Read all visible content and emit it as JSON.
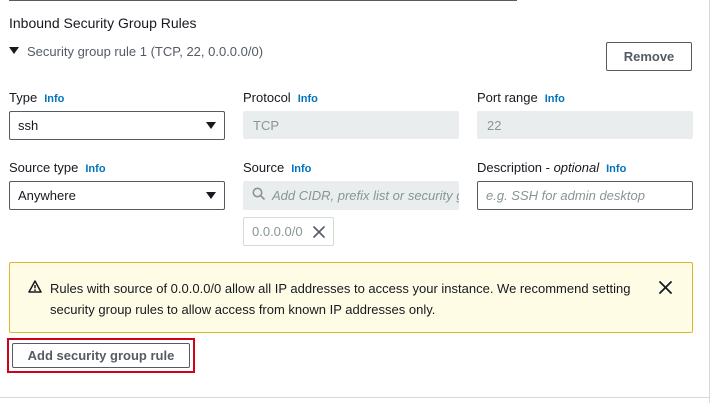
{
  "section": {
    "title": "Inbound Security Group Rules"
  },
  "rule": {
    "header": "Security group rule 1 (TCP, 22, 0.0.0.0/0)",
    "remove_label": "Remove"
  },
  "fields": {
    "info_label": "Info",
    "type": {
      "label": "Type",
      "value": "ssh"
    },
    "protocol": {
      "label": "Protocol",
      "value": "TCP"
    },
    "port_range": {
      "label": "Port range",
      "value": "22"
    },
    "source_type": {
      "label": "Source type",
      "value": "Anywhere"
    },
    "source": {
      "label": "Source",
      "placeholder": "Add CIDR, prefix list or security g",
      "token": "0.0.0.0/0"
    },
    "description": {
      "label": "Description - ",
      "label_optional": "optional",
      "placeholder": "e.g. SSH for admin desktop"
    }
  },
  "alert": {
    "message": "Rules with source of 0.0.0.0/0 allow all IP addresses to access your instance. We recommend setting security group rules to allow access from known IP addresses only.",
    "icon": "warning-icon"
  },
  "actions": {
    "add_rule_label": "Add security group rule"
  },
  "colors": {
    "info_link": "#0073bb",
    "alert_background": "#fffce6",
    "alert_border": "#dfb52c",
    "highlight_border": "#d0021b",
    "disabled_fill": "#eaeded"
  }
}
